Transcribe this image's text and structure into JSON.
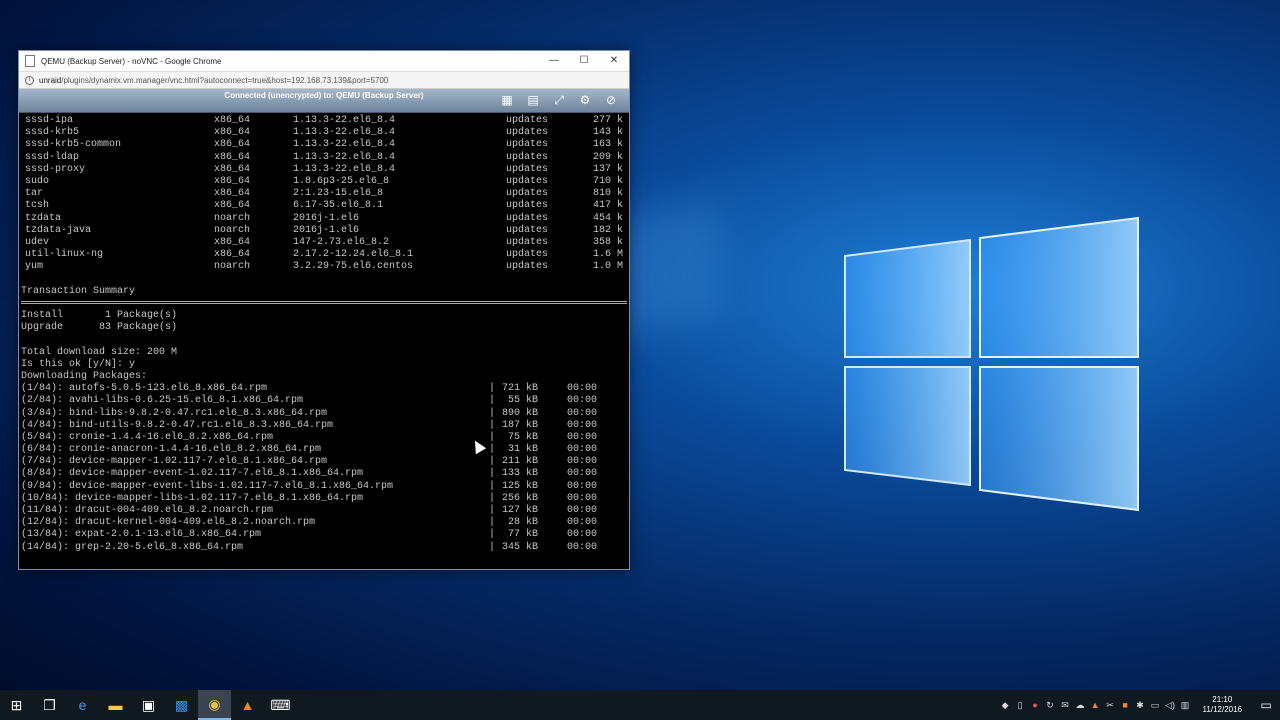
{
  "window": {
    "title": "QEMU (Backup Server) - noVNC - Google Chrome",
    "url_host": "unraid",
    "url_path": "/plugins/dynamix.vm.manager/vnc.html?autoconnect=true&host=192.168.73.139&port=5700",
    "minimize": "—",
    "maximize": "☐",
    "close": "✕"
  },
  "novnc": {
    "status": "Connected (unencrypted) to: QEMU (Backup Server)"
  },
  "packages": [
    {
      "name": "sssd-ipa",
      "arch": "x86_64",
      "version": "1.13.3-22.el6_8.4",
      "repo": "updates",
      "size": "277 k"
    },
    {
      "name": "sssd-krb5",
      "arch": "x86_64",
      "version": "1.13.3-22.el6_8.4",
      "repo": "updates",
      "size": "143 k"
    },
    {
      "name": "sssd-krb5-common",
      "arch": "x86_64",
      "version": "1.13.3-22.el6_8.4",
      "repo": "updates",
      "size": "163 k"
    },
    {
      "name": "sssd-ldap",
      "arch": "x86_64",
      "version": "1.13.3-22.el6_8.4",
      "repo": "updates",
      "size": "209 k"
    },
    {
      "name": "sssd-proxy",
      "arch": "x86_64",
      "version": "1.13.3-22.el6_8.4",
      "repo": "updates",
      "size": "137 k"
    },
    {
      "name": "sudo",
      "arch": "x86_64",
      "version": "1.8.6p3-25.el6_8",
      "repo": "updates",
      "size": "710 k"
    },
    {
      "name": "tar",
      "arch": "x86_64",
      "version": "2:1.23-15.el6_8",
      "repo": "updates",
      "size": "810 k"
    },
    {
      "name": "tcsh",
      "arch": "x86_64",
      "version": "6.17-35.el6_8.1",
      "repo": "updates",
      "size": "417 k"
    },
    {
      "name": "tzdata",
      "arch": "noarch",
      "version": "2016j-1.el6",
      "repo": "updates",
      "size": "454 k"
    },
    {
      "name": "tzdata-java",
      "arch": "noarch",
      "version": "2016j-1.el6",
      "repo": "updates",
      "size": "182 k"
    },
    {
      "name": "udev",
      "arch": "x86_64",
      "version": "147-2.73.el6_8.2",
      "repo": "updates",
      "size": "358 k"
    },
    {
      "name": "util-linux-ng",
      "arch": "x86_64",
      "version": "2.17.2-12.24.el6_8.1",
      "repo": "updates",
      "size": "1.6 M"
    },
    {
      "name": "yum",
      "arch": "noarch",
      "version": "3.2.29-75.el6.centos",
      "repo": "updates",
      "size": "1.0 M"
    }
  ],
  "summary": {
    "heading": "Transaction Summary",
    "install_label": "Install",
    "install_count": "1 Package(s)",
    "upgrade_label": "Upgrade",
    "upgrade_count": "83 Package(s)",
    "total_download": "Total download size: 200 M",
    "prompt": "Is this ok [y/N]: y",
    "downloading": "Downloading Packages:"
  },
  "downloads": [
    {
      "file": "(1/84): autofs-5.0.5-123.el6_8.x86_64.rpm",
      "size": "721 kB",
      "time": "00:00"
    },
    {
      "file": "(2/84): avahi-libs-0.6.25-15.el6_8.1.x86_64.rpm",
      "size": "55 kB",
      "time": "00:00"
    },
    {
      "file": "(3/84): bind-libs-9.8.2-0.47.rc1.el6_8.3.x86_64.rpm",
      "size": "890 kB",
      "time": "00:00"
    },
    {
      "file": "(4/84): bind-utils-9.8.2-0.47.rc1.el6_8.3.x86_64.rpm",
      "size": "187 kB",
      "time": "00:00"
    },
    {
      "file": "(5/84): cronie-1.4.4-16.el6_8.2.x86_64.rpm",
      "size": "75 kB",
      "time": "00:00"
    },
    {
      "file": "(6/84): cronie-anacron-1.4.4-16.el6_8.2.x86_64.rpm",
      "size": "31 kB",
      "time": "00:00"
    },
    {
      "file": "(7/84): device-mapper-1.02.117-7.el6_8.1.x86_64.rpm",
      "size": "211 kB",
      "time": "00:00"
    },
    {
      "file": "(8/84): device-mapper-event-1.02.117-7.el6_8.1.x86_64.rpm",
      "size": "133 kB",
      "time": "00:00"
    },
    {
      "file": "(9/84): device-mapper-event-libs-1.02.117-7.el6_8.1.x86_64.rpm",
      "size": "125 kB",
      "time": "00:00"
    },
    {
      "file": "(10/84): device-mapper-libs-1.02.117-7.el6_8.1.x86_64.rpm",
      "size": "256 kB",
      "time": "00:00"
    },
    {
      "file": "(11/84): dracut-004-409.el6_8.2.noarch.rpm",
      "size": "127 kB",
      "time": "00:00"
    },
    {
      "file": "(12/84): dracut-kernel-004-409.el6_8.2.noarch.rpm",
      "size": "28 kB",
      "time": "00:00"
    },
    {
      "file": "(13/84): expat-2.0.1-13.el6_8.x86_64.rpm",
      "size": "77 kB",
      "time": "00:00"
    },
    {
      "file": "(14/84): grep-2.20-5.el6_8.x86_64.rpm",
      "size": "345 kB",
      "time": "00:00"
    }
  ],
  "taskbar": {
    "clock_time": "21:10",
    "clock_date": "11/12/2016"
  }
}
